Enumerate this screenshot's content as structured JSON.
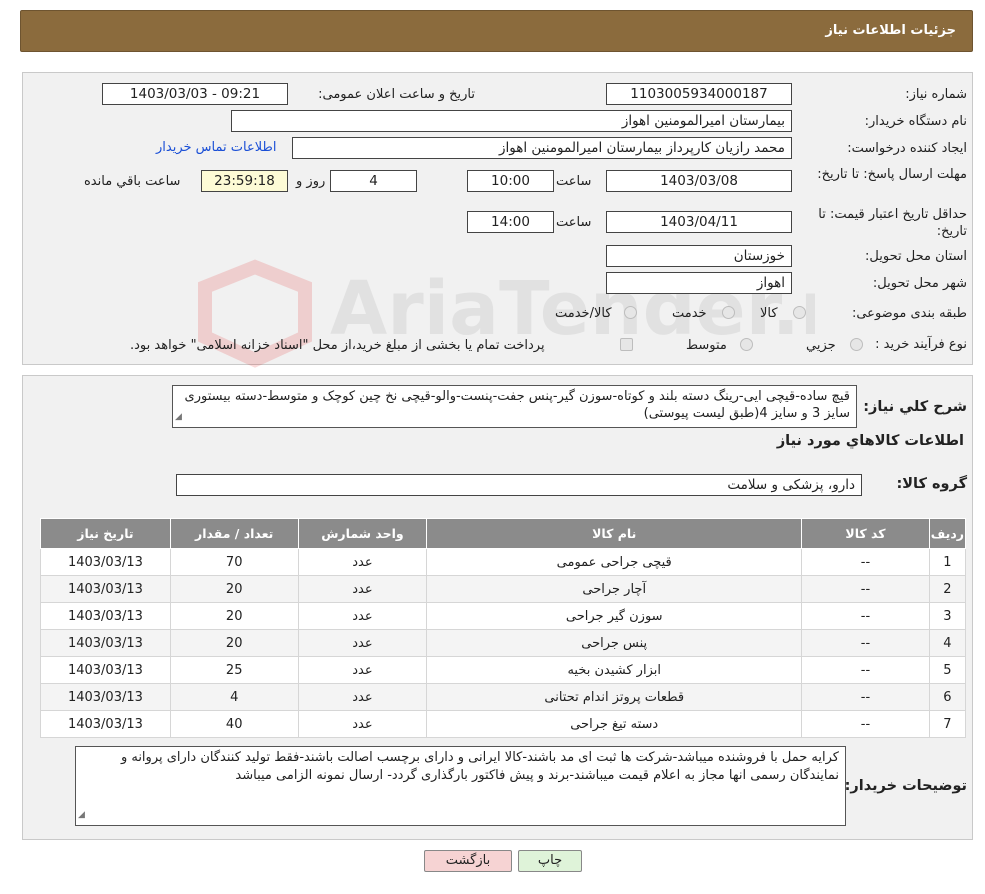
{
  "header": {
    "title": "جزئیات اطلاعات نیاز"
  },
  "form": {
    "need_number_label": "شماره نیاز:",
    "need_number": "1103005934000187",
    "announce_label": "تاریخ و ساعت اعلان عمومی:",
    "announce_value": "1403/03/03 - 09:21",
    "buyer_org_label": "نام دستگاه خریدار:",
    "buyer_org": "بیمارستان امیرالمومنین اهواز",
    "creator_label": "ایجاد کننده درخواست:",
    "creator": "محمد رازیان کارپرداز بیمارستان امیرالمومنین اهواز",
    "contact_link": "اطلاعات تماس خریدار",
    "deadline_label": "مهلت ارسال پاسخ: تا تاریخ:",
    "deadline_date": "1403/03/08",
    "time_label": "ساعت",
    "deadline_time": "10:00",
    "days_value": "4",
    "days_label": "روز و",
    "remaining_time": "23:59:18",
    "remaining_label": "ساعت باقي مانده",
    "price_validity_label": "حداقل تاریخ اعتبار قیمت: تا تاریخ:",
    "price_validity_date": "1403/04/11",
    "price_validity_time": "14:00",
    "province_label": "استان محل تحویل:",
    "province": "خوزستان",
    "city_label": "شهر محل تحویل:",
    "city": "اهواز",
    "category_label": "طبقه بندی موضوعی:",
    "category_options": [
      "کالا",
      "خدمت",
      "کالا/خدمت"
    ],
    "process_label": "نوع فرآیند خرید :",
    "process_options": [
      "جزيي",
      "متوسط"
    ],
    "process_note": "پرداخت تمام یا بخشی از مبلغ خرید،از محل \"اسناد خزانه اسلامی\" خواهد بود."
  },
  "summary": {
    "label": "شرح کلي نياز:",
    "text": "قیچ ساده-قیچی ایی-رینگ دسته بلند و کوتاه-سوزن گیر-پنس جفت-پنست-والو-قیچی نخ چین کوچک و متوسط-دسته بیستوری سایز 3 و سایز 4(طبق لیست پیوستی)",
    "items_title": "اطلاعات کالاهاي مورد نياز",
    "group_label": "گروه کالا:",
    "group_value": "دارو، پزشکی و سلامت"
  },
  "table": {
    "headers": [
      "رديف",
      "کد کالا",
      "نام کالا",
      "واحد شمارش",
      "تعداد / مقدار",
      "تاریخ نیاز"
    ],
    "rows": [
      [
        "1",
        "--",
        "قیچی جراحی عمومی",
        "عدد",
        "70",
        "1403/03/13"
      ],
      [
        "2",
        "--",
        "آچار جراحی",
        "عدد",
        "20",
        "1403/03/13"
      ],
      [
        "3",
        "--",
        "سوزن گیر جراحی",
        "عدد",
        "20",
        "1403/03/13"
      ],
      [
        "4",
        "--",
        "پنس جراحی",
        "عدد",
        "20",
        "1403/03/13"
      ],
      [
        "5",
        "--",
        "ابزار کشیدن بخیه",
        "عدد",
        "25",
        "1403/03/13"
      ],
      [
        "6",
        "--",
        "قطعات پروتز اندام تحتانی",
        "عدد",
        "4",
        "1403/03/13"
      ],
      [
        "7",
        "--",
        "دسته تیغ جراحی",
        "عدد",
        "40",
        "1403/03/13"
      ]
    ]
  },
  "buyer_notes": {
    "label": "توضیحات خریدار:",
    "text": "کرایه حمل با فروشنده میباشد-شرکت ها ثبت ای مد باشند-کالا ایرانی و دارای برچسب اصالت باشند-فقط تولید کنندگان دارای پروانه و نمایندگان رسمی انها مجاز به اعلام قیمت میباشند-برند و پیش فاکتور بارگذاری گردد- ارسال نمونه الزامی میباشد"
  },
  "buttons": {
    "print": "چاپ",
    "back": "بازگشت"
  },
  "watermark": {
    "brand": "AriaTender.neT"
  },
  "colors": {
    "header": "#8b6b3d",
    "link": "#1a4fd6",
    "table_head": "#8b8b8b",
    "back_button": "#f6d3d3",
    "print_button": "#dff3d9"
  }
}
